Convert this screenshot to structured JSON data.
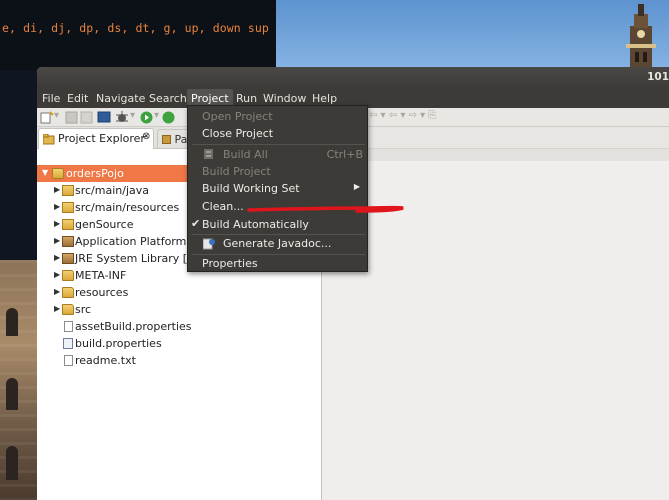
{
  "terminal": {
    "text": "e, di, dj, dp, ds, dt, g, up, down sup"
  },
  "window": {
    "title": "101"
  },
  "menubar": {
    "items": [
      {
        "label": "File"
      },
      {
        "label": "Edit"
      },
      {
        "label": "Navigate"
      },
      {
        "label": "Search"
      },
      {
        "label": "Project"
      },
      {
        "label": "Run"
      },
      {
        "label": "Window"
      },
      {
        "label": "Help"
      }
    ]
  },
  "explorer": {
    "tab_label": "Project Explorer",
    "tab_close": "⊗",
    "other_tab_label": "Pac",
    "tree": [
      {
        "label": "ordersPojo",
        "icon": "project-folder-icon"
      },
      {
        "label": "src/main/java",
        "icon": "package-folder-icon"
      },
      {
        "label": "src/main/resources",
        "icon": "package-folder-icon"
      },
      {
        "label": "genSource",
        "icon": "package-folder-icon"
      },
      {
        "label": "Application Platform Ir",
        "icon": "library-icon"
      },
      {
        "label": "JRE System Library [Jav",
        "icon": "library-icon"
      },
      {
        "label": "META-INF",
        "icon": "folder-icon"
      },
      {
        "label": "resources",
        "icon": "folder-icon"
      },
      {
        "label": "src",
        "icon": "folder-icon"
      },
      {
        "label": "assetBuild.properties",
        "icon": "file-icon"
      },
      {
        "label": "build.properties",
        "icon": "properties-file-icon"
      },
      {
        "label": "readme.txt",
        "icon": "file-icon"
      }
    ]
  },
  "project_menu": {
    "items": [
      {
        "label": "Open Project",
        "enabled": false
      },
      {
        "label": "Close Project",
        "enabled": true
      },
      {
        "label": "Build All",
        "enabled": false,
        "shortcut": "Ctrl+B"
      },
      {
        "label": "Build Project",
        "enabled": false
      },
      {
        "label": "Build Working Set",
        "enabled": true,
        "submenu": "▶"
      },
      {
        "label": "Clean...",
        "enabled": true
      },
      {
        "label": "Build Automatically",
        "enabled": true,
        "checked": "✔"
      },
      {
        "label": "Generate Javadoc...",
        "enabled": true
      },
      {
        "label": "Properties",
        "enabled": true
      }
    ]
  },
  "colors": {
    "selection": "#f07746",
    "menu_bg": "#3c3b37",
    "annotation": "#e0141b",
    "terminal_text": "#e8823c"
  }
}
